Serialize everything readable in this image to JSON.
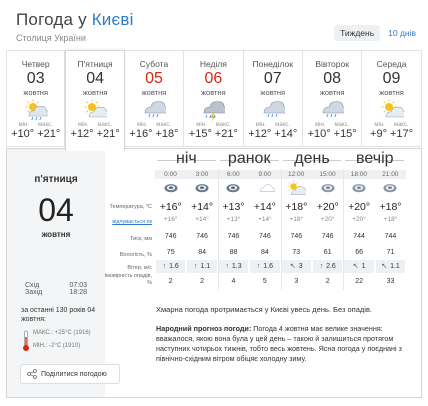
{
  "header": {
    "title_prefix": "Погода у ",
    "city": "Києві",
    "subtitle": "Столиця України",
    "period_active": "Тиждень",
    "period_link": "10 днів"
  },
  "days": [
    {
      "name": "Четвер",
      "num": "03",
      "month": "жовтня",
      "min_label": "мін.",
      "max_label": "макс.",
      "min": "+10°",
      "max": "+21°",
      "weekend": false,
      "icon": "partly-cloudy-rain-icon"
    },
    {
      "name": "П'ятниця",
      "num": "04",
      "month": "жовтня",
      "min_label": "мін.",
      "max_label": "макс.",
      "min": "+12°",
      "max": "+21°",
      "weekend": false,
      "icon": "partly-cloudy-icon"
    },
    {
      "name": "Субота",
      "num": "05",
      "month": "жовтня",
      "min_label": "мін.",
      "max_label": "макс.",
      "min": "+16°",
      "max": "+18°",
      "weekend": true,
      "icon": "cloudy-rain-icon"
    },
    {
      "name": "Неділя",
      "num": "06",
      "month": "жовтня",
      "min_label": "мін.",
      "max_label": "макс.",
      "min": "+15°",
      "max": "+21°",
      "weekend": true,
      "icon": "thunderstorm-icon"
    },
    {
      "name": "Понеділок",
      "num": "07",
      "month": "жовтня",
      "min_label": "мін.",
      "max_label": "макс.",
      "min": "+12°",
      "max": "+14°",
      "weekend": false,
      "icon": "cloudy-rain-icon"
    },
    {
      "name": "Вівторок",
      "num": "08",
      "month": "жовтня",
      "min_label": "мін.",
      "max_label": "макс.",
      "min": "+10°",
      "max": "+15°",
      "weekend": false,
      "icon": "cloudy-rain-icon"
    },
    {
      "name": "Середа",
      "num": "09",
      "month": "жовтня",
      "min_label": "мін.",
      "max_label": "макс.",
      "min": "+9°",
      "max": "+17°",
      "weekend": false,
      "icon": "partly-cloudy-icon"
    }
  ],
  "detail": {
    "day_name": "п'ятниця",
    "day_num": "04",
    "month": "жовтня",
    "sunrise_label": "Схід",
    "sunrise": "07:03",
    "sunset_label": "Захід",
    "sunset": "18:28",
    "history_title": "за останні 130 років 04 жовтня:",
    "history_max": "МАКС.: +25°C (1916)",
    "history_min": "МІН.: -2°C (1910)",
    "share_label": "Поділитися погодою"
  },
  "table": {
    "times_of_day": [
      "ніч",
      "ранок",
      "день",
      "вечір"
    ],
    "hours": [
      "0:00",
      "3:00",
      "6:00",
      "9:00",
      "12:00",
      "15:00",
      "18:00",
      "21:00"
    ],
    "icons": [
      "night-cloudy-icon",
      "night-cloudy-icon",
      "night-cloudy-icon",
      "cloud-icon",
      "partly-cloudy-icon",
      "cloudy-icon",
      "cloudy-icon",
      "cloudy-icon"
    ],
    "temp_label": "Температура, °C",
    "temp": [
      "+16°",
      "+14°",
      "+13°",
      "+14°",
      "+18°",
      "+20°",
      "+20°",
      "+18°"
    ],
    "feels_label": "відчувається як",
    "feels": [
      "+16°",
      "+14°",
      "+13°",
      "+14°",
      "+18°",
      "+20°",
      "+20°",
      "+18°"
    ],
    "pressure_label": "Тиск, мм",
    "pressure": [
      "746",
      "746",
      "746",
      "746",
      "746",
      "746",
      "744",
      "744"
    ],
    "humidity_label": "Вологість, %",
    "humidity": [
      "75",
      "84",
      "88",
      "84",
      "73",
      "61",
      "66",
      "71"
    ],
    "wind_label": "Вітер, м/с",
    "wind": [
      "1.6",
      "1.1",
      "1.3",
      "1.6",
      "3",
      "2.6",
      "1",
      "1.1"
    ],
    "wind_dirs": [
      "↑",
      "↑",
      "↑",
      "↑",
      "↖",
      "↑",
      "↖",
      "↖"
    ],
    "precip_label": "Імовірність опадів, %",
    "precip": [
      "2",
      "2",
      "4",
      "5",
      "3",
      "2",
      "22",
      "33"
    ]
  },
  "description": "Хмарна погода протримається у Києві увесь день. Без опадів.",
  "folk_label": "Народний прогноз погоди:",
  "folk_text": " Погода 4 жовтня має велике значення: вважалося, якою вона була у цей день – такою й залишиться протягом наступних чотирьох тижнів, тобто весь жовтень. Ясна погода у поєднані з північно-східним вітром обіцяє холодну зиму."
}
